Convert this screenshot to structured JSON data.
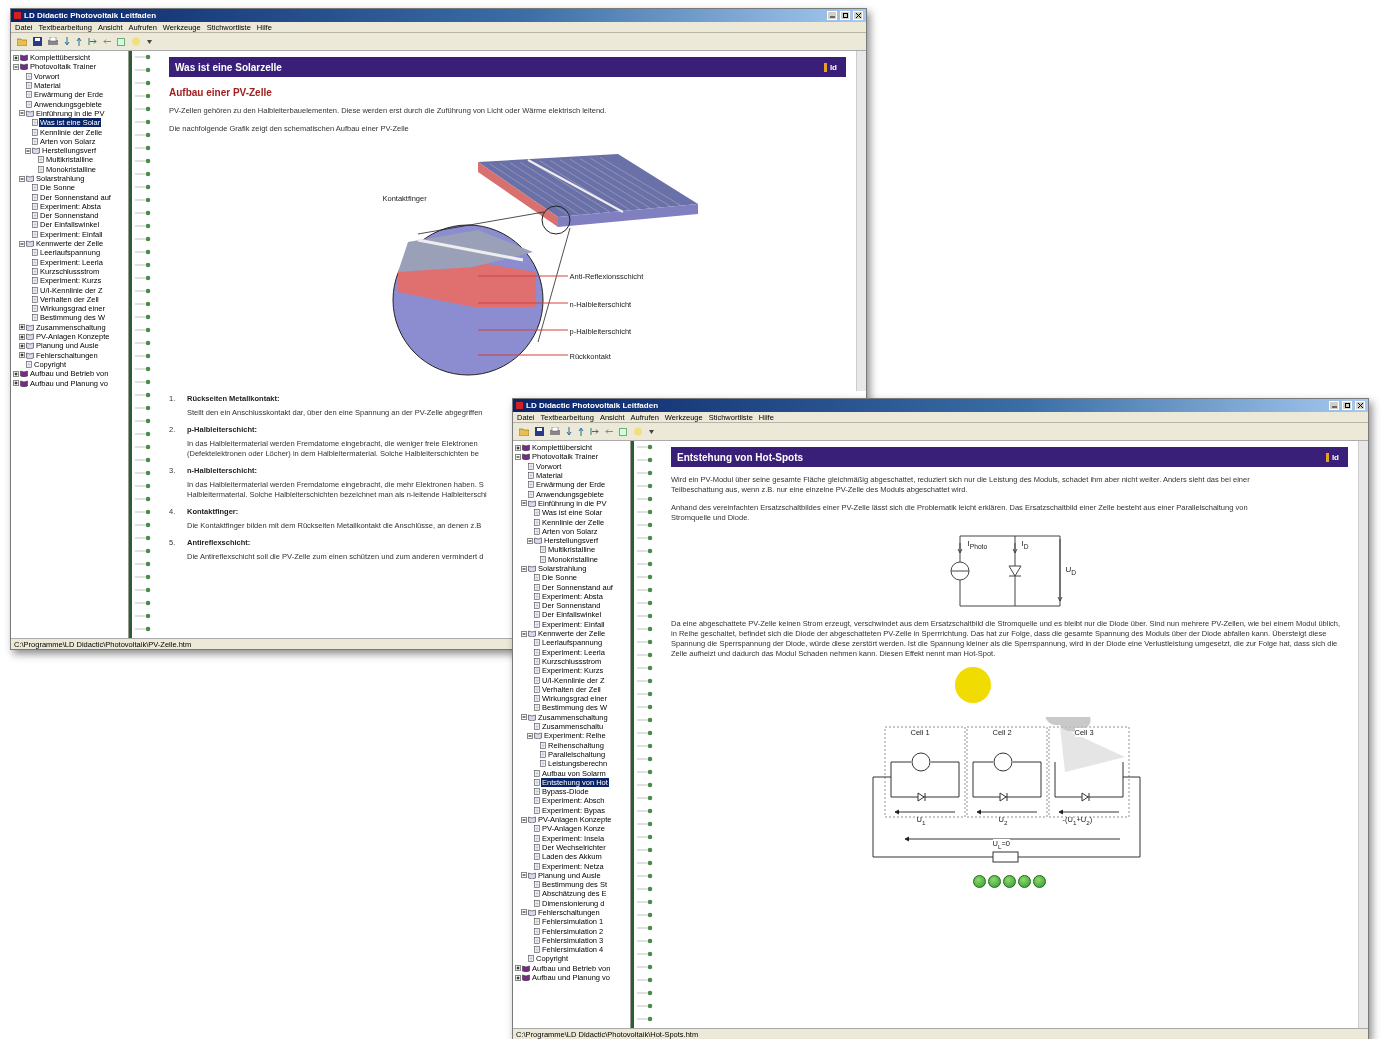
{
  "windows": [
    {
      "title": "LD Didactic Photovoltaik Leitfaden",
      "menu": [
        "Datei",
        "Textbearbeitung",
        "Ansicht",
        "Aufrufen",
        "Werkzeuge",
        "Stichwortliste",
        "Hilfe"
      ],
      "tree": [
        {
          "label": "Komplettübersicht",
          "kind": "book",
          "expanded": false,
          "selected": false
        },
        {
          "label": "Photovoltaik Trainer",
          "kind": "book",
          "expanded": true,
          "selected": false,
          "children": [
            {
              "label": "Vorwort",
              "kind": "page",
              "selected": false
            },
            {
              "label": "Material",
              "kind": "page",
              "selected": false
            },
            {
              "label": "Erwärmung der Erde",
              "kind": "page",
              "selected": false
            },
            {
              "label": "Anwendungsgebiete",
              "kind": "page",
              "selected": false
            },
            {
              "label": "Einführung in die PV",
              "kind": "book",
              "expanded": true,
              "selected": false,
              "children": [
                {
                  "label": "Was ist eine Solar",
                  "kind": "page",
                  "selected": true
                },
                {
                  "label": "Kennlinie der Zelle",
                  "kind": "page",
                  "selected": false
                },
                {
                  "label": "Arten von Solarz",
                  "kind": "page",
                  "selected": false
                },
                {
                  "label": "Herstellungsverf",
                  "kind": "book",
                  "expanded": true,
                  "selected": false,
                  "children": [
                    {
                      "label": "Multikristalline",
                      "kind": "page",
                      "selected": false
                    },
                    {
                      "label": "Monokristalline",
                      "kind": "page",
                      "selected": false
                    }
                  ]
                }
              ]
            },
            {
              "label": "Solarstrahlung",
              "kind": "book",
              "expanded": true,
              "selected": false,
              "children": [
                {
                  "label": "Die Sonne",
                  "kind": "page",
                  "selected": false
                },
                {
                  "label": "Der Sonnenstand auf",
                  "kind": "page",
                  "selected": false
                },
                {
                  "label": "Experiment: Absta",
                  "kind": "page",
                  "selected": false
                },
                {
                  "label": "Der Sonnenstand",
                  "kind": "page",
                  "selected": false
                },
                {
                  "label": "Der Einfallswinkel",
                  "kind": "page",
                  "selected": false
                },
                {
                  "label": "Experiment: Einfall",
                  "kind": "page",
                  "selected": false
                }
              ]
            },
            {
              "label": "Kennwerte der Zelle",
              "kind": "book",
              "expanded": true,
              "selected": false,
              "children": [
                {
                  "label": "Leerlaufspannung",
                  "kind": "page",
                  "selected": false
                },
                {
                  "label": "Experiment: Leerla",
                  "kind": "page",
                  "selected": false
                },
                {
                  "label": "Kurzschlussstrom",
                  "kind": "page",
                  "selected": false
                },
                {
                  "label": "Experiment: Kurzs",
                  "kind": "page",
                  "selected": false
                },
                {
                  "label": "U/I-Kennlinie der Z",
                  "kind": "page",
                  "selected": false
                },
                {
                  "label": "Verhalten der Zell",
                  "kind": "page",
                  "selected": false
                },
                {
                  "label": "Wirkungsgrad einer",
                  "kind": "page",
                  "selected": false
                },
                {
                  "label": "Bestimmung des W",
                  "kind": "page",
                  "selected": false
                }
              ]
            },
            {
              "label": "Zusammenschaltung",
              "kind": "book",
              "expanded": false,
              "selected": false
            },
            {
              "label": "PV-Anlagen Konzepte",
              "kind": "book",
              "expanded": false,
              "selected": false
            },
            {
              "label": "Planung und Ausle",
              "kind": "book",
              "expanded": false,
              "selected": false
            },
            {
              "label": "Fehlerschaltungen",
              "kind": "book",
              "expanded": false,
              "selected": false
            },
            {
              "label": "Copyright",
              "kind": "page",
              "selected": false
            }
          ]
        },
        {
          "label": "Aufbau und Betrieb von",
          "kind": "book",
          "expanded": false,
          "selected": false
        },
        {
          "label": "Aufbau und Planung vo",
          "kind": "book",
          "expanded": false,
          "selected": false
        }
      ],
      "banner": "Was ist eine Solarzelle",
      "logo": "ld",
      "heading": "Aufbau einer PV-Zelle",
      "paragraphs": [
        "PV-Zellen gehören zu den Halbleiterbauelementen. Diese werden erst durch die Zuführung von Licht oder Wärme elektrisch leitend.",
        "Die nachfolgende Grafik zeigt den schematischen Aufbau einer PV-Zelle"
      ],
      "figure": {
        "kind": "cell",
        "labels": [
          "Kontaktfinger",
          "Anti-Reflexionsschicht",
          "n-Halbleiterschicht",
          "p-Halbleiterschicht",
          "Rückkontakt"
        ]
      },
      "list": [
        {
          "number": "1.",
          "term": "Rückseiten Metallkontakt:",
          "text": "Stellt den ein Anschlusskontakt dar, über den eine Spannung an der PV-Zelle abgegriffen"
        },
        {
          "number": "2.",
          "term": "p-Halbleiterschicht:",
          "text": "In das Halbleitermaterial werden Fremdatome eingebracht, die weniger freie Elektronen (Defektelektronen oder Löcher) in dem Halbleitermaterial. Solche Halbleiterschichten be"
        },
        {
          "number": "3.",
          "term": "n-Halbleiterschicht:",
          "text": "In das Halbleitermaterial werden Fremdatome eingebracht, die mehr Elektronen haben. S Halbleitermaterial. Solche Halbleiterschichten bezeichnet man als n-leitende Halbleiterschi"
        },
        {
          "number": "4.",
          "term": "Kontaktfinger:",
          "text": "Die Kontaktfinger bilden mit dem Rückseiten Metallkontakt die Anschlüsse, an denen z.B"
        },
        {
          "number": "5.",
          "term": "Antireflexschicht:",
          "text": "Die Antireflexschicht soll die PV-Zelle zum einen schützen und zum anderen vermindert d"
        }
      ],
      "status": "C:\\Programme\\LD Didactic\\Photovoltaik\\PV-Zelle.htm"
    },
    {
      "title": "LD Didactic Photovoltaik Leitfaden",
      "menu": [
        "Datei",
        "Textbearbeitung",
        "Ansicht",
        "Aufrufen",
        "Werkzeuge",
        "Stichwortliste",
        "Hilfe"
      ],
      "tree": [
        {
          "label": "Komplettübersicht",
          "kind": "book",
          "expanded": false,
          "selected": false
        },
        {
          "label": "Photovoltaik Trainer",
          "kind": "book",
          "expanded": true,
          "selected": false,
          "children": [
            {
              "label": "Vorwort",
              "kind": "page",
              "selected": false
            },
            {
              "label": "Material",
              "kind": "page",
              "selected": false
            },
            {
              "label": "Erwärmung der Erde",
              "kind": "page",
              "selected": false
            },
            {
              "label": "Anwendungsgebiete",
              "kind": "page",
              "selected": false
            },
            {
              "label": "Einführung in die PV",
              "kind": "book",
              "expanded": true,
              "selected": false,
              "children": [
                {
                  "label": "Was ist eine Solar",
                  "kind": "page",
                  "selected": false
                },
                {
                  "label": "Kennlinie der Zelle",
                  "kind": "page",
                  "selected": false
                },
                {
                  "label": "Arten von Solarz",
                  "kind": "page",
                  "selected": false
                },
                {
                  "label": "Herstellungsverf",
                  "kind": "book",
                  "expanded": true,
                  "selected": false,
                  "children": [
                    {
                      "label": "Multikristalline",
                      "kind": "page",
                      "selected": false
                    },
                    {
                      "label": "Monokristalline",
                      "kind": "page",
                      "selected": false
                    }
                  ]
                }
              ]
            },
            {
              "label": "Solarstrahlung",
              "kind": "book",
              "expanded": true,
              "selected": false,
              "children": [
                {
                  "label": "Die Sonne",
                  "kind": "page",
                  "selected": false
                },
                {
                  "label": "Der Sonnenstand auf",
                  "kind": "page",
                  "selected": false
                },
                {
                  "label": "Experiment: Absta",
                  "kind": "page",
                  "selected": false
                },
                {
                  "label": "Der Sonnenstand",
                  "kind": "page",
                  "selected": false
                },
                {
                  "label": "Der Einfallswinkel",
                  "kind": "page",
                  "selected": false
                },
                {
                  "label": "Experiment: Einfall",
                  "kind": "page",
                  "selected": false
                }
              ]
            },
            {
              "label": "Kennwerte der Zelle",
              "kind": "book",
              "expanded": true,
              "selected": false,
              "children": [
                {
                  "label": "Leerlaufspannung",
                  "kind": "page",
                  "selected": false
                },
                {
                  "label": "Experiment: Leerla",
                  "kind": "page",
                  "selected": false
                },
                {
                  "label": "Kurzschlussstrom",
                  "kind": "page",
                  "selected": false
                },
                {
                  "label": "Experiment: Kurzs",
                  "kind": "page",
                  "selected": false
                },
                {
                  "label": "U/I-Kennlinie der Z",
                  "kind": "page",
                  "selected": false
                },
                {
                  "label": "Verhalten der Zell",
                  "kind": "page",
                  "selected": false
                },
                {
                  "label": "Wirkungsgrad einer",
                  "kind": "page",
                  "selected": false
                },
                {
                  "label": "Bestimmung des W",
                  "kind": "page",
                  "selected": false
                }
              ]
            },
            {
              "label": "Zusammenschaltung",
              "kind": "book",
              "expanded": true,
              "selected": false,
              "children": [
                {
                  "label": "Zusammenschaltu",
                  "kind": "page",
                  "selected": false
                },
                {
                  "label": "Experiment: Reihe",
                  "kind": "book",
                  "expanded": true,
                  "selected": false,
                  "children": [
                    {
                      "label": "Reihenschaltung",
                      "kind": "page",
                      "selected": false
                    },
                    {
                      "label": "Parallelschaltung",
                      "kind": "page",
                      "selected": false
                    },
                    {
                      "label": "Leistungsberechn",
                      "kind": "page",
                      "selected": false
                    }
                  ]
                },
                {
                  "label": "Aufbau von Solarm",
                  "kind": "page",
                  "selected": false
                },
                {
                  "label": "Entstehung von Hot",
                  "kind": "page",
                  "selected": true
                },
                {
                  "label": "Bypass-Diode",
                  "kind": "page",
                  "selected": false
                },
                {
                  "label": "Experiment: Absch",
                  "kind": "page",
                  "selected": false
                },
                {
                  "label": "Experiment: Bypas",
                  "kind": "page",
                  "selected": false
                }
              ]
            },
            {
              "label": "PV-Anlagen Konzepte",
              "kind": "book",
              "expanded": true,
              "selected": false,
              "children": [
                {
                  "label": "PV-Anlagen Konze",
                  "kind": "page",
                  "selected": false
                },
                {
                  "label": "Experiment: Insela",
                  "kind": "page",
                  "selected": false
                },
                {
                  "label": "Der Wechselrichter",
                  "kind": "page",
                  "selected": false
                },
                {
                  "label": "Laden des Akkum",
                  "kind": "page",
                  "selected": false
                },
                {
                  "label": "Experiment: Netza",
                  "kind": "page",
                  "selected": false
                }
              ]
            },
            {
              "label": "Planung und Ausle",
              "kind": "book",
              "expanded": true,
              "selected": false,
              "children": [
                {
                  "label": "Bestimmung des St",
                  "kind": "page",
                  "selected": false
                },
                {
                  "label": "Abschätzung des E",
                  "kind": "page",
                  "selected": false
                },
                {
                  "label": "Dimensionierung d",
                  "kind": "page",
                  "selected": false
                }
              ]
            },
            {
              "label": "Fehlerschaltungen",
              "kind": "book",
              "expanded": true,
              "selected": false,
              "children": [
                {
                  "label": "Fehlersimulation 1",
                  "kind": "page",
                  "selected": false
                },
                {
                  "label": "Fehlersimulation 2",
                  "kind": "page",
                  "selected": false
                },
                {
                  "label": "Fehlersimulation 3",
                  "kind": "page",
                  "selected": false
                },
                {
                  "label": "Fehlersimulation 4",
                  "kind": "page",
                  "selected": false
                }
              ]
            },
            {
              "label": "Copyright",
              "kind": "page",
              "selected": false
            }
          ]
        },
        {
          "label": "Aufbau und Betrieb von",
          "kind": "book",
          "expanded": false,
          "selected": false
        },
        {
          "label": "Aufbau und Planung vo",
          "kind": "book",
          "expanded": false,
          "selected": false
        }
      ],
      "banner": "Entstehung von Hot-Spots",
      "logo": "ld",
      "paragraphs": [
        "Wird ein PV-Modul über seine gesamte Fläche gleichmäßig abgeschattet, reduziert sich nur die Leistung des Moduls, schadet ihm aber nicht weiter. Anders sieht das bei einer Teilbeschattung aus, wenn z.B. nur eine einzelne PV-Zelle des Moduls abgeschattet wird.",
        "Anhand des vereinfachten Ersatzschaltbildes einer PV-Zelle lässt sich die Problematik leicht erklären. Das Ersatzschaltbild einer Zelle besteht aus einer Parallelschaltung von Stromquelle und Diode."
      ],
      "circuit": {
        "kind": "equivalent",
        "labels": [
          "I$_{Photo}$",
          "I$_{D}$",
          "U$_{D}$"
        ]
      },
      "paragraphs_after": [
        "Da eine abgeschattete PV-Zelle keinen Strom erzeugt, verschwindet aus dem Ersatzschaltbild die Stromquelle und es bleibt nur die Diode über. Sind nun mehrere PV-Zellen, wie bei einem Modul üblich, in Reihe geschaltet, befindet sich die Diode der abgeschatteten PV-Zelle in Sperrrichtung. Das hat zur Folge, dass die gesamte Spannung des Moduls über der Diode abfallen kann. Übersteigt diese Spannung die Sperrspannung der Diode, würde diese zerstört werden. Ist die Spannung kleiner als die Sperrspannung, wird in der Diode eine Verlustleistung umgesetzt, die zur Folge hat, dass sich die Zelle aufheizt und dadurch das Modul Schaden nehmen kann. Diesen Effekt nennt man Hot-Spot."
      ],
      "module": {
        "kind": "series",
        "cells": [
          {
            "label": "Cell 1",
            "voltage": "U$_{1}$",
            "shaded": false
          },
          {
            "label": "Cell 2",
            "voltage": "U$_{2}$",
            "shaded": false
          },
          {
            "label": "Cell 3",
            "voltage": "-(U$_{1}$+U$_{2}$)",
            "shaded": true
          }
        ],
        "load": "U$_{L}$=0"
      },
      "status": "C:\\Programme\\LD Didactic\\Photovoltaik\\Hot-Spots.htm"
    }
  ]
}
